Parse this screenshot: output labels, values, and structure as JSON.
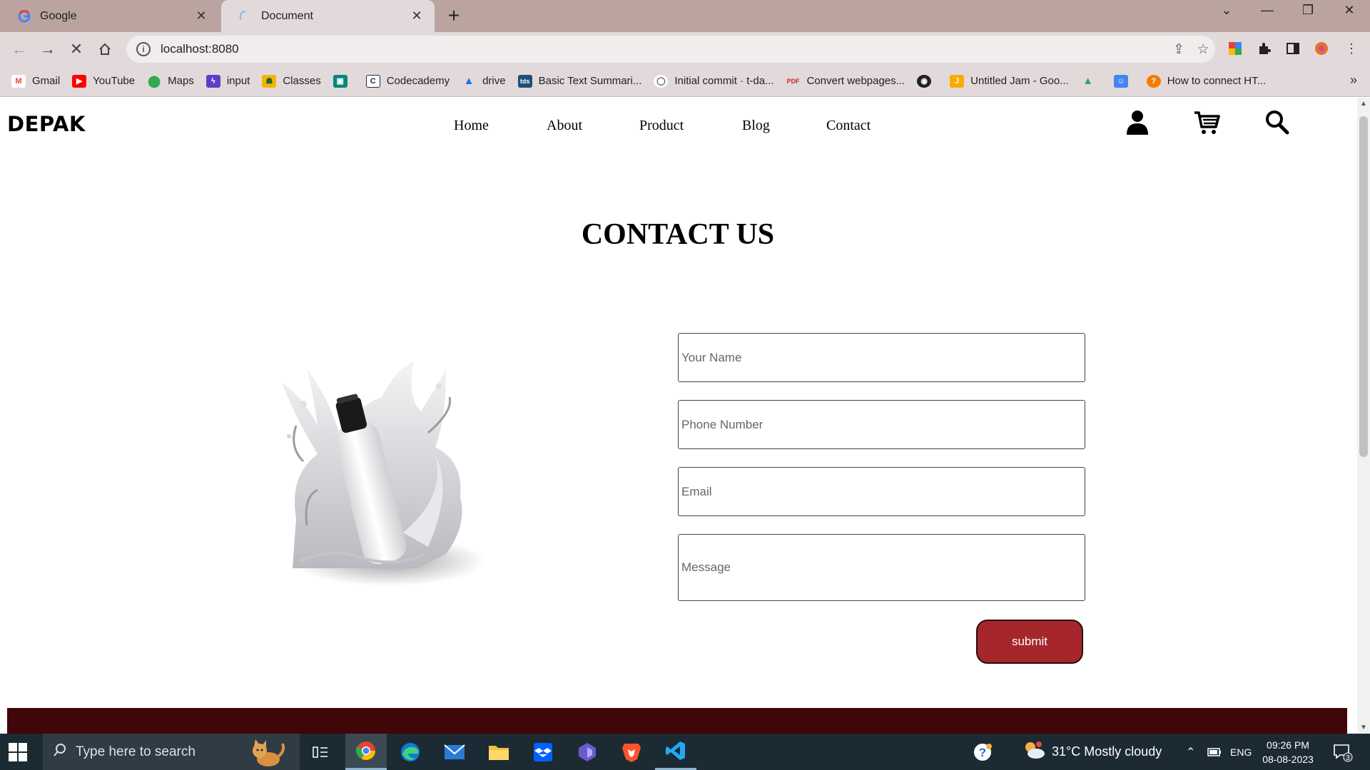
{
  "browser": {
    "tabs": [
      {
        "title": "Google",
        "favicon": "google-g-icon",
        "active": false
      },
      {
        "title": "Document",
        "favicon": "loading-spinner-icon",
        "active": true
      }
    ],
    "url": "localhost:8080",
    "bookmarks": [
      {
        "label": "Gmail",
        "icon": "gmail-icon",
        "color": "#ea4335"
      },
      {
        "label": "YouTube",
        "icon": "youtube-icon",
        "color": "#ff0000"
      },
      {
        "label": "Maps",
        "icon": "maps-icon",
        "color": "#34a853"
      },
      {
        "label": "input",
        "icon": "bolt-icon",
        "color": "#5b3fc9"
      },
      {
        "label": "Classes",
        "icon": "classroom-icon",
        "color": "#f4b400"
      },
      {
        "label": "",
        "icon": "meet-icon",
        "color": "#00897b"
      },
      {
        "label": "Codecademy",
        "icon": "codecademy-icon",
        "color": "#1f2a44"
      },
      {
        "label": "drive",
        "icon": "drive-icon",
        "color": "#1a73e8"
      },
      {
        "label": "Basic Text Summari...",
        "icon": "tds-icon",
        "color": "#1f4e79"
      },
      {
        "label": "Initial commit · t-da...",
        "icon": "github-icon",
        "color": "#ffffff"
      },
      {
        "label": "Convert webpages...",
        "icon": "pdf-icon",
        "color": "#c62828"
      },
      {
        "label": "",
        "icon": "globe-icon",
        "color": "#222222"
      },
      {
        "label": "Untitled Jam - Goo...",
        "icon": "jamboard-icon",
        "color": "#f9ab00"
      },
      {
        "label": "",
        "icon": "drive-icon",
        "color": "#1a73e8"
      },
      {
        "label": "",
        "icon": "contacts-icon",
        "color": "#4285f4"
      },
      {
        "label": "How to connect HT...",
        "icon": "bookmark-site-icon",
        "color": "#f57c00"
      }
    ]
  },
  "site": {
    "logo": "DEPAK",
    "nav": [
      "Home",
      "About",
      "Product",
      "Blog",
      "Contact"
    ],
    "heading": "CONTACT US",
    "form": {
      "name_placeholder": "Your Name",
      "phone_placeholder": "Phone Number",
      "email_placeholder": "Email",
      "message_placeholder": "Message",
      "submit_label": "submit"
    },
    "colors": {
      "submit": "#a5272b",
      "footer": "#400608"
    }
  },
  "taskbar": {
    "search_placeholder": "Type here to search",
    "weather": "31°C  Mostly cloudy",
    "language": "ENG",
    "time": "09:26 PM",
    "date": "08-08-2023",
    "notification_count": "3",
    "apps": [
      "task-view-icon",
      "chrome-icon",
      "edge-icon",
      "mail-icon",
      "file-explorer-icon",
      "dropbox-icon",
      "app-icon",
      "brave-icon",
      "vscode-icon"
    ]
  }
}
